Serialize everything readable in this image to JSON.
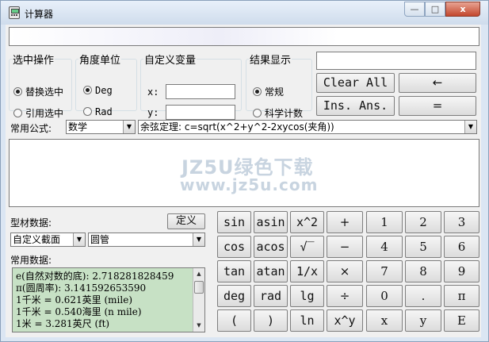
{
  "window": {
    "title": "计算器",
    "min_icon": "—",
    "max_icon": "□",
    "close_icon": "x"
  },
  "select_op": {
    "legend": "选中操作",
    "opt1": "替换选中",
    "opt2": "引用选中"
  },
  "angle": {
    "legend": "角度单位",
    "opt1": "Deg",
    "opt2": "Rad"
  },
  "custom_var": {
    "legend": "自定义变量",
    "x_label": "x:",
    "y_label": "y:"
  },
  "result_display": {
    "legend": "结果显示",
    "opt1": "常规",
    "opt2": "科学计数"
  },
  "ops": {
    "clear_all": "Clear All",
    "backspace": "←",
    "ins_ans": "Ins. Ans.",
    "equals": "="
  },
  "formula": {
    "label": "常用公式:",
    "category": "数学",
    "selected": "余弦定理: c=sqrt(x^2+y^2-2xycos(夹角))"
  },
  "watermark": {
    "text": "JZ5U绿色下载",
    "url": "www.jz5u.com"
  },
  "profile": {
    "label": "型材数据:",
    "define_button": "定义",
    "section": "自定义截面",
    "shape": "圆管"
  },
  "constants": {
    "label": "常用数据:",
    "items": [
      "e(自然对数的底): 2.718281828459",
      "π(圆周率): 3.141592653590",
      "1千米 = 0.621英里 (mile)",
      "1千米 = 0.540海里 (n mile)",
      "1米 = 3.281英尺 (ft)"
    ]
  },
  "keypad": {
    "func": [
      [
        "sin",
        "asin",
        "x^2"
      ],
      [
        "cos",
        "acos",
        "√‾"
      ],
      [
        "tan",
        "atan",
        "1/x"
      ],
      [
        "deg",
        "rad",
        "lg"
      ],
      [
        "(",
        ")",
        "ln"
      ]
    ],
    "ops": [
      "+",
      "−",
      "×",
      "÷",
      "x^y"
    ],
    "digits": [
      [
        "1",
        "2",
        "3"
      ],
      [
        "4",
        "5",
        "6"
      ],
      [
        "7",
        "8",
        "9"
      ],
      [
        "0",
        ".",
        "π"
      ],
      [
        "x",
        "y",
        "E"
      ]
    ]
  },
  "colors": {
    "constants_bg": "#c7e1c5",
    "window_bg": "#dbe6f3",
    "close_button": "#c3472d"
  }
}
